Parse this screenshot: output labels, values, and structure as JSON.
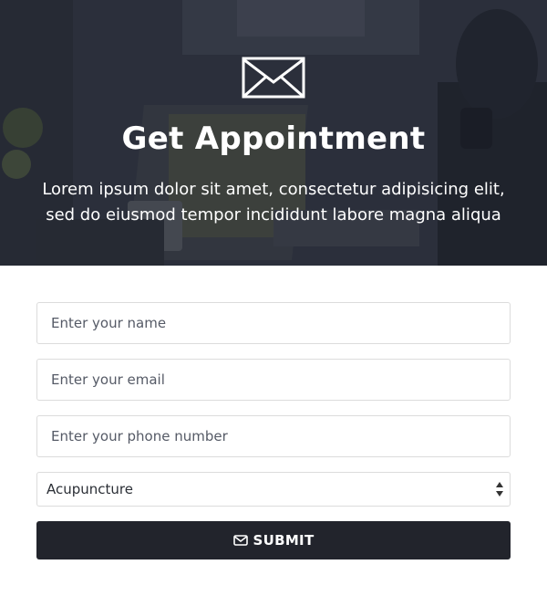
{
  "hero": {
    "icon": "envelope-icon",
    "title": "Get Appointment",
    "description": "Lorem ipsum dolor sit amet, consectetur adipisicing elit, sed do eiusmod tempor incididunt labore magna aliqua"
  },
  "form": {
    "name": {
      "placeholder": "Enter your name",
      "value": ""
    },
    "email": {
      "placeholder": "Enter your email",
      "value": ""
    },
    "phone": {
      "placeholder": "Enter your phone number",
      "value": ""
    },
    "service": {
      "selected": "Acupuncture",
      "icon": "select-arrows-icon"
    },
    "submit": {
      "label": "SUBMIT",
      "icon": "envelope-icon"
    }
  },
  "colors": {
    "button_bg": "#22242c",
    "text_white": "#ffffff",
    "border": "#dcdcdc"
  }
}
